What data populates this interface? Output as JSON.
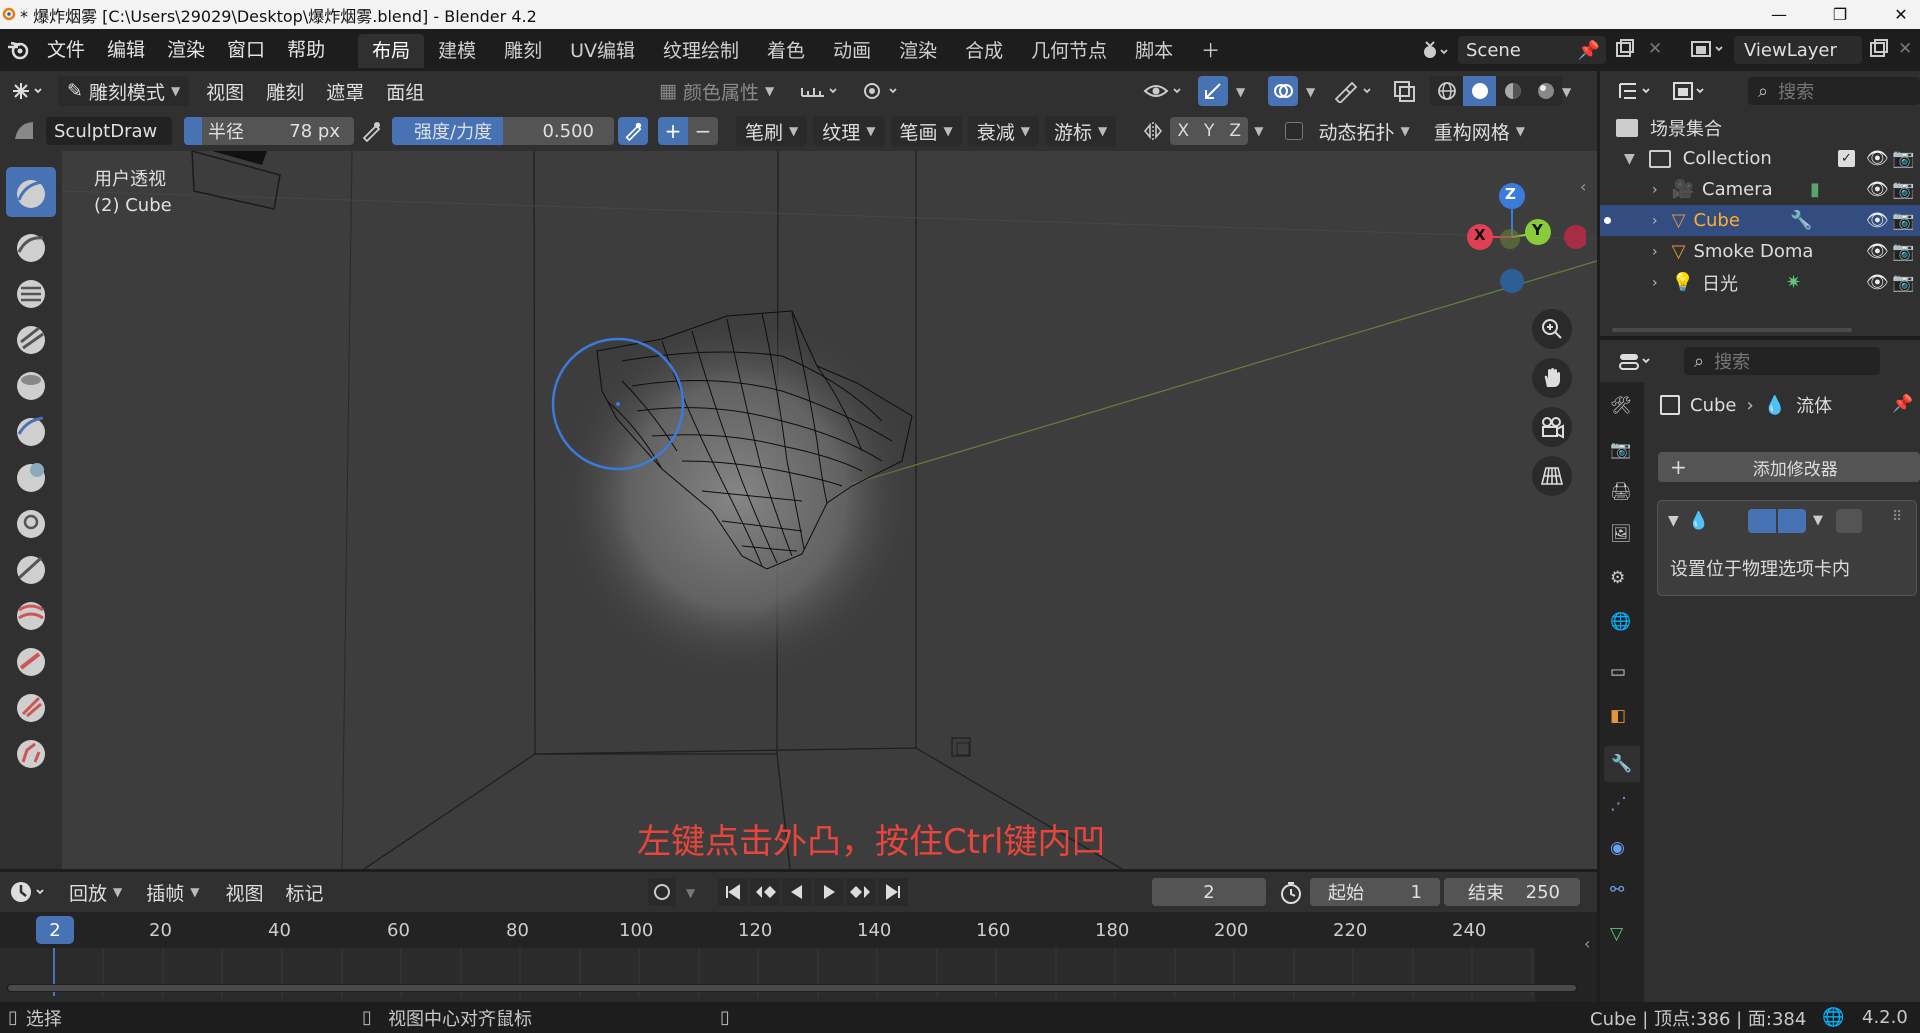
{
  "window": {
    "title": "* 爆炸烟雾 [C:\\Users\\29029\\Desktop\\爆炸烟雾.blend] - Blender 4.2"
  },
  "menubar": {
    "menus": [
      "文件",
      "编辑",
      "渲染",
      "窗口",
      "帮助"
    ],
    "workspaces": [
      "布局",
      "建模",
      "雕刻",
      "UV编辑",
      "纹理绘制",
      "着色",
      "动画",
      "渲染",
      "合成",
      "几何节点",
      "脚本"
    ],
    "active_workspace": "布局",
    "scene": "Scene",
    "view_layer": "ViewLayer"
  },
  "header": {
    "mode": "雕刻模式",
    "menus": [
      "视图",
      "雕刻",
      "遮罩",
      "面组"
    ],
    "color_attr": "颜色属性"
  },
  "tool_header": {
    "brush": "SculptDraw",
    "radius_label": "半径",
    "radius_value": "78 px",
    "strength_label": "强度/力度",
    "strength_value": "0.500",
    "dropdowns": [
      "笔刷",
      "纹理",
      "笔画",
      "衰减",
      "游标"
    ],
    "axes": [
      "X",
      "Y",
      "Z"
    ],
    "dyntopo": "动态拓扑",
    "remesh": "重构网格"
  },
  "viewport": {
    "view_name": "用户透视",
    "object_info": "(2) Cube",
    "instruction": "左键点击外凸，按住Ctrl键内凹",
    "gizmo": {
      "z": "Z",
      "y": "Y",
      "x": "X"
    }
  },
  "timeline": {
    "menus": [
      "回放",
      "插帧",
      "视图",
      "标记"
    ],
    "current_frame": "2",
    "start_label": "起始",
    "start_value": "1",
    "end_label": "结束",
    "end_value": "250",
    "ticks": [
      "20",
      "40",
      "60",
      "80",
      "100",
      "120",
      "140",
      "160",
      "180",
      "200",
      "220",
      "240"
    ],
    "playhead": "2"
  },
  "outliner": {
    "search_placeholder": "搜索",
    "scene_collection": "场景集合",
    "collection": "Collection",
    "items": [
      {
        "name": "Camera",
        "icon": "camera-icon",
        "color": "#e2963b"
      },
      {
        "name": "Cube",
        "icon": "mesh-icon",
        "color": "#e2963b",
        "selected": true
      },
      {
        "name": "Smoke Doma",
        "icon": "mesh-icon",
        "color": "#e2963b"
      },
      {
        "name": "日光",
        "icon": "light-icon",
        "color": "#e2963b"
      }
    ]
  },
  "properties": {
    "search_placeholder": "搜索",
    "breadcrumb_object": "Cube",
    "breadcrumb_modifier": "流体",
    "add_modifier": "添加修改器",
    "modifier_note": "设置位于物理选项卡内"
  },
  "statusbar": {
    "select": "选择",
    "center_view": "视图中心对齐鼠标",
    "stats": "Cube | 顶点:386 | 面:384",
    "version": "4.2.0"
  },
  "colors": {
    "accent": "#4772b3",
    "selected_text": "#ffaf29",
    "instruction": "#e8463c",
    "bg": "#3d3d3d"
  }
}
